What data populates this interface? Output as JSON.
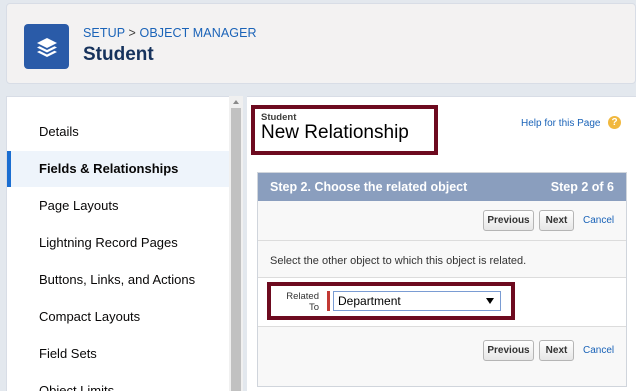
{
  "header": {
    "breadcrumb_setup": "SETUP",
    "breadcrumb_sep": " > ",
    "breadcrumb_object_manager": "OBJECT MANAGER",
    "title": "Student",
    "icon": "layers-icon"
  },
  "sidebar": {
    "items": [
      {
        "label": "Details",
        "active": false
      },
      {
        "label": "Fields & Relationships",
        "active": true
      },
      {
        "label": "Page Layouts",
        "active": false
      },
      {
        "label": "Lightning Record Pages",
        "active": false
      },
      {
        "label": "Buttons, Links, and Actions",
        "active": false
      },
      {
        "label": "Compact Layouts",
        "active": false
      },
      {
        "label": "Field Sets",
        "active": false
      },
      {
        "label": "Object Limits",
        "active": false
      }
    ]
  },
  "main": {
    "subtitle": "Student",
    "title": "New Relationship",
    "help_link": "Help for this Page",
    "help_icon": "?",
    "step": {
      "heading": "Step 2. Choose the related object",
      "progress": "Step 2 of 6"
    },
    "buttons": {
      "previous": "Previous",
      "next": "Next",
      "cancel": "Cancel"
    },
    "instruction": "Select the other object to which this object is related.",
    "field": {
      "label": "Related To",
      "value": "Department"
    }
  },
  "colors": {
    "accent": "#1b6ed1",
    "highlight_box": "#6d0a1f",
    "step_header": "#8a9ebe",
    "required": "#c23934"
  }
}
